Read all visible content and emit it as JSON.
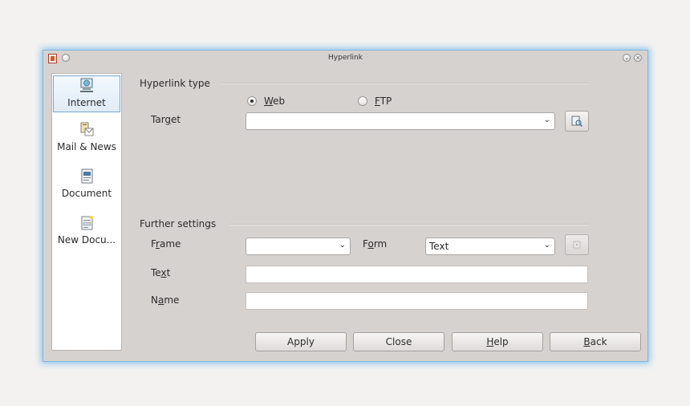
{
  "window": {
    "title": "Hyperlink"
  },
  "sidebar": {
    "items": [
      {
        "label": "Internet",
        "icon": "internet-icon",
        "selected": true
      },
      {
        "label": "Mail & News",
        "icon": "mail-news-icon",
        "selected": false
      },
      {
        "label": "Document",
        "icon": "document-icon",
        "selected": false
      },
      {
        "label": "New Docu...",
        "icon": "new-document-icon",
        "selected": false
      }
    ]
  },
  "hyperlink_type": {
    "heading": "Hyperlink type",
    "web_radio": {
      "pre": "",
      "mnemonic": "W",
      "post": "eb",
      "checked": true
    },
    "ftp_radio": {
      "pre": "",
      "mnemonic": "F",
      "post": "TP",
      "checked": false
    },
    "target_label": {
      "pre": "Tar",
      "mnemonic": "g",
      "post": "et"
    },
    "target_value": ""
  },
  "further_settings": {
    "heading": "Further settings",
    "frame_label": {
      "pre": "F",
      "mnemonic": "r",
      "post": "ame"
    },
    "frame_value": "",
    "form_label": {
      "pre": "F",
      "mnemonic": "o",
      "post": "rm"
    },
    "form_value": "Text",
    "text_label": {
      "pre": "Te",
      "mnemonic": "x",
      "post": "t"
    },
    "text_value": "",
    "name_label": {
      "pre": "N",
      "mnemonic": "a",
      "post": "me"
    },
    "name_value": ""
  },
  "buttons": {
    "apply": {
      "pre": "Apply",
      "mnemonic": "",
      "post": ""
    },
    "close": {
      "pre": "Close",
      "mnemonic": "",
      "post": ""
    },
    "help": {
      "pre": "",
      "mnemonic": "H",
      "post": "elp"
    },
    "back": {
      "pre": "",
      "mnemonic": "B",
      "post": "ack"
    }
  },
  "colors": {
    "window_bg": "#d6d2d0",
    "focus_glow": "#7fb8dd",
    "selection": "#dfecf8"
  }
}
